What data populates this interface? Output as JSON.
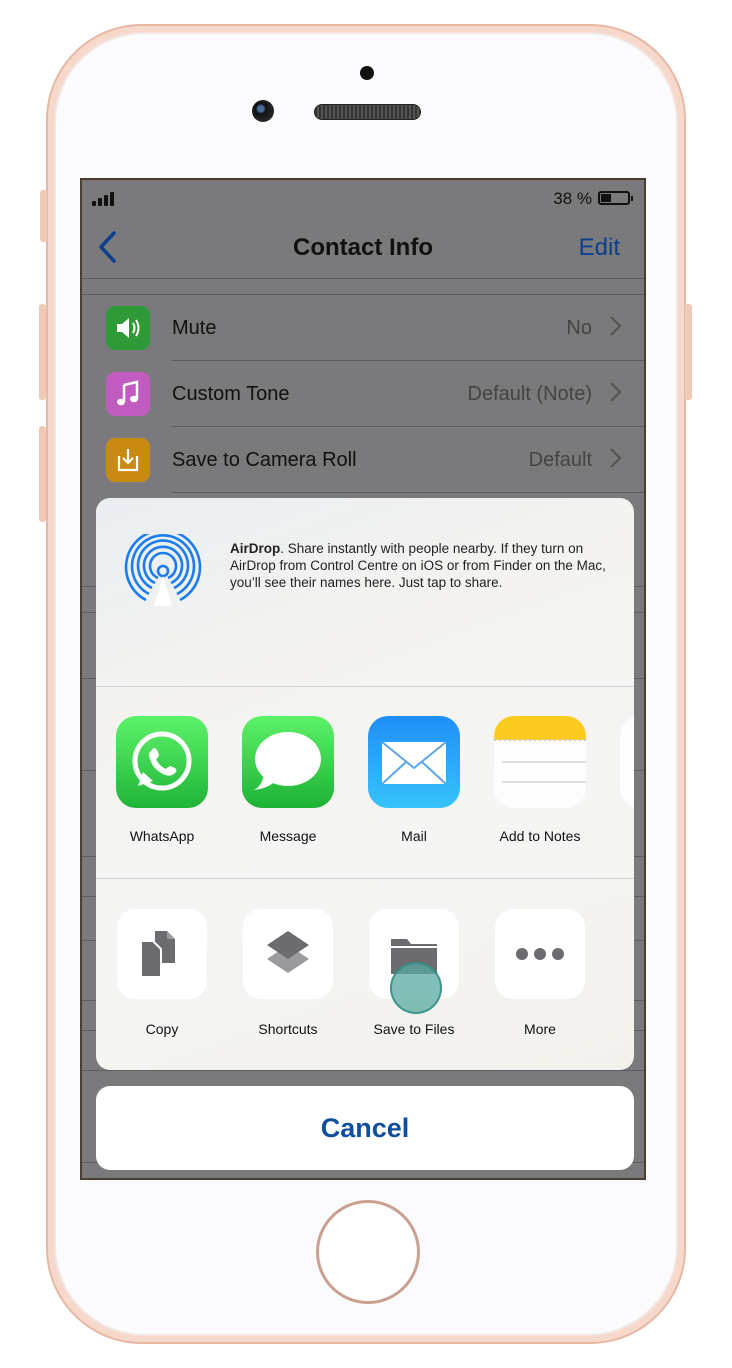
{
  "status_bar": {
    "battery_text": "38 %",
    "battery_level": 0.38
  },
  "nav": {
    "back_icon": "chevron-left-icon",
    "title": "Contact Info",
    "edit_label": "Edit"
  },
  "settings": [
    {
      "label": "Mute",
      "value": "No",
      "icon": "speaker-icon",
      "color": "#2e9a38"
    },
    {
      "label": "Custom Tone",
      "value": "Default (Note)",
      "icon": "music-note-icon",
      "color": "#c15bbf"
    },
    {
      "label": "Save to Camera Roll",
      "value": "Default",
      "icon": "download-icon",
      "color": "#c98a12"
    }
  ],
  "airdrop": {
    "title": "AirDrop",
    "text": ". Share instantly with people nearby. If they turn on AirDrop from Control Centre on iOS or from Finder on the Mac, you’ll see their names here. Just tap to share.",
    "color": "#1a7cf0"
  },
  "apps": [
    {
      "name": "WhatsApp",
      "icon": "whatsapp-icon"
    },
    {
      "name": "Message",
      "icon": "message-icon"
    },
    {
      "name": "Mail",
      "icon": "mail-icon"
    },
    {
      "name": "Add to Notes",
      "icon": "notes-icon"
    }
  ],
  "actions": [
    {
      "name": "Copy",
      "icon": "copy-icon"
    },
    {
      "name": "Shortcuts",
      "icon": "shortcuts-icon"
    },
    {
      "name": "Save to Files",
      "icon": "folder-icon"
    },
    {
      "name": "More",
      "icon": "more-icon"
    }
  ],
  "cancel_label": "Cancel"
}
